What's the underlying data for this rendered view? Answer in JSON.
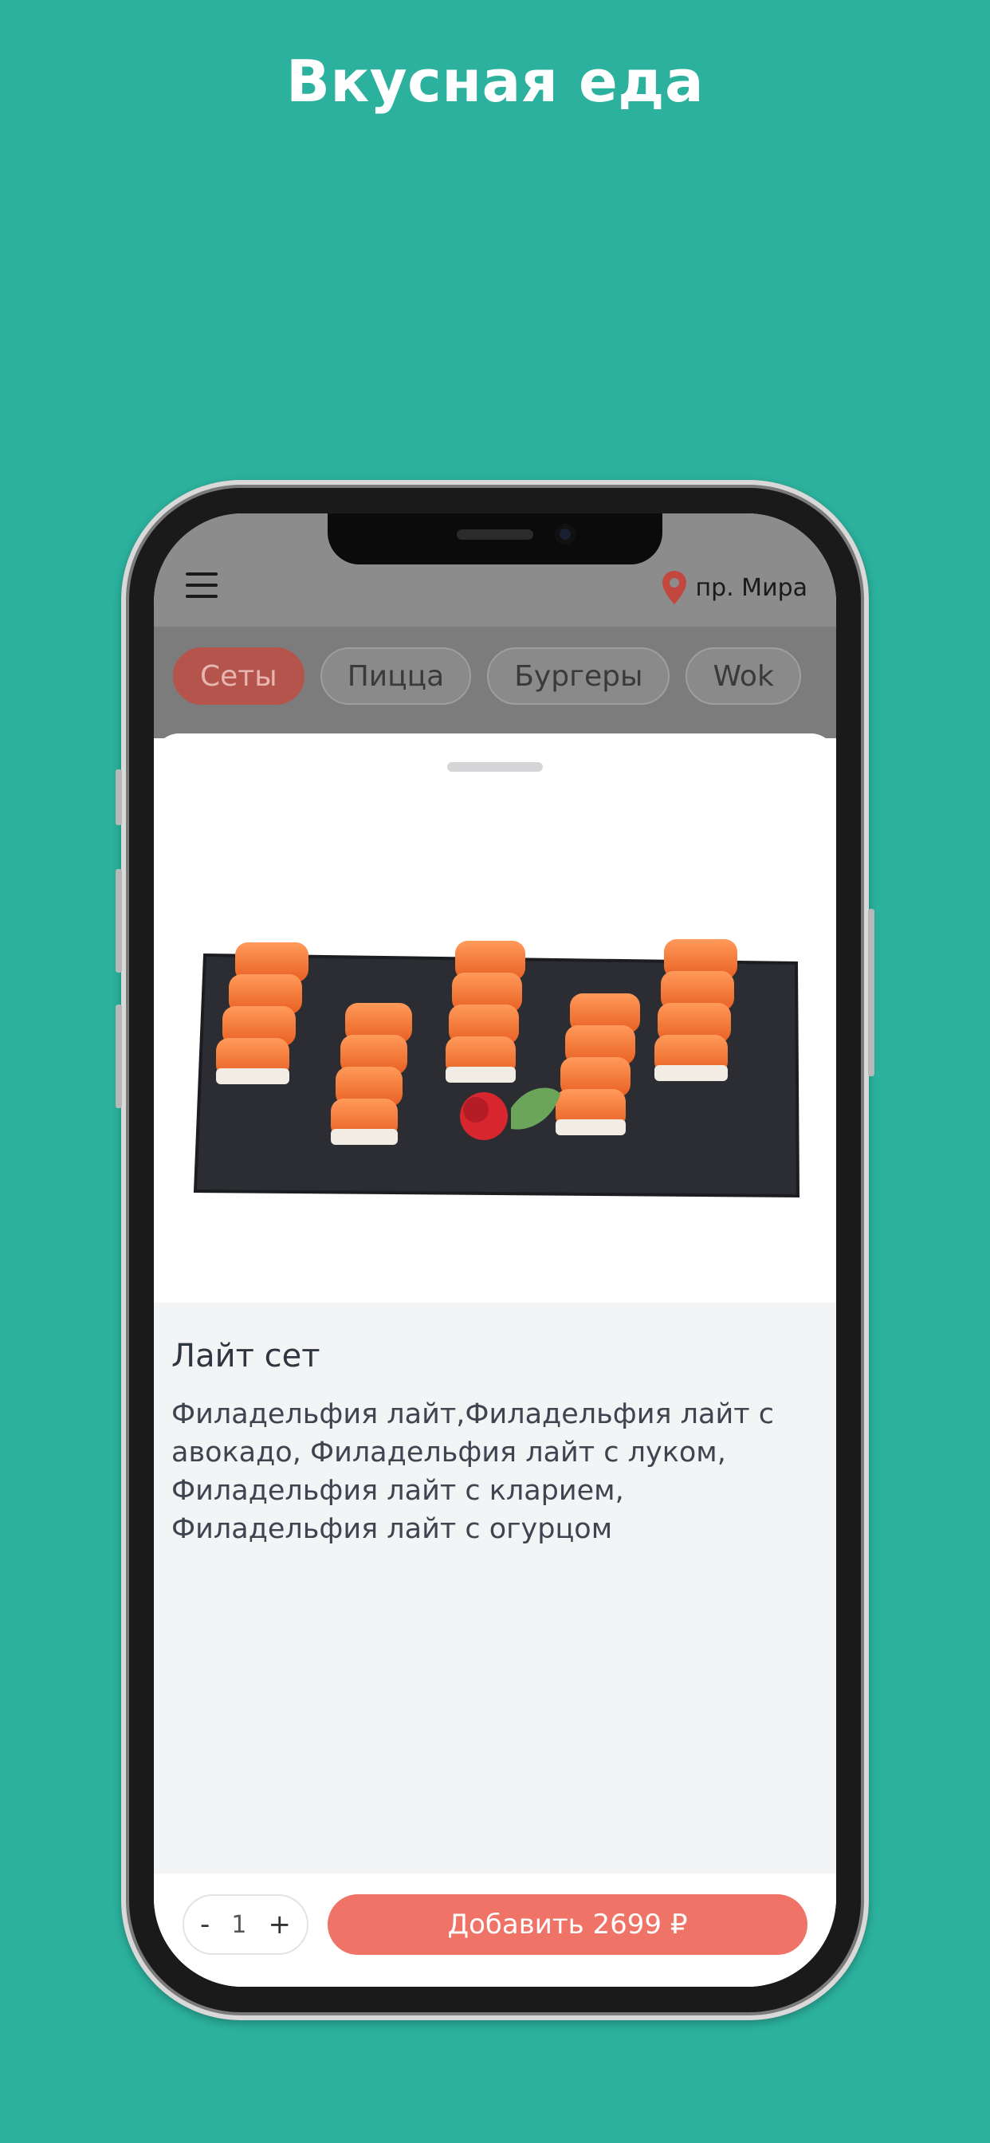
{
  "headline": "Вкусная еда",
  "header": {
    "location": "пр. Мира",
    "pin_color": "#c2473f"
  },
  "categories": [
    {
      "label": "Сеты",
      "active": true
    },
    {
      "label": "Пицца",
      "active": false
    },
    {
      "label": "Бургеры",
      "active": false
    },
    {
      "label": "Wok",
      "active": false
    }
  ],
  "product": {
    "title": "Лайт сет",
    "description": "Филадельфия лайт,Филадельфия лайт с авокадо, Филадельфия лайт с луком, Филадельфия лайт с кларием, Филадельфия лайт с огурцом"
  },
  "cart": {
    "minus": "-",
    "quantity": "1",
    "plus": "+",
    "add_label": "Добавить 2699 ₽"
  },
  "colors": {
    "background": "#2bb19d",
    "accent": "#ef7366"
  }
}
